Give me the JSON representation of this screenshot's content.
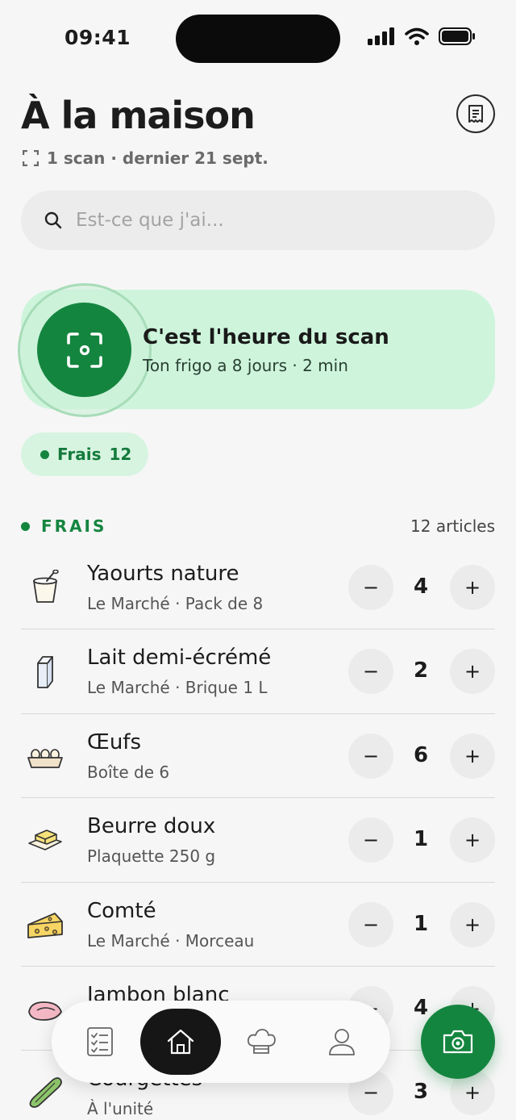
{
  "status_bar": {
    "time": "09:41"
  },
  "header": {
    "title": "À la maison",
    "scan_meta": "1 scan · dernier 21 sept."
  },
  "search": {
    "placeholder": "Est-ce que j'ai..."
  },
  "scan_card": {
    "title": "C'est l'heure du scan",
    "subtitle": "Ton frigo a 8 jours · 2 min"
  },
  "filter_chip": {
    "label": "Frais",
    "count": "12"
  },
  "section": {
    "title": "FRAIS",
    "count": "12 articles"
  },
  "items": [
    {
      "name": "Yaourts nature",
      "sub": "Le Marché · Pack de 8",
      "qty": "4",
      "icon": "yogurt-icon"
    },
    {
      "name": "Lait demi-écrémé",
      "sub": "Le Marché · Brique 1 L",
      "qty": "2",
      "icon": "milk-carton-icon"
    },
    {
      "name": "Œufs",
      "sub": "Boîte de 6",
      "qty": "6",
      "icon": "egg-box-icon"
    },
    {
      "name": "Beurre doux",
      "sub": "Plaquette 250 g",
      "qty": "1",
      "icon": "butter-icon"
    },
    {
      "name": "Comté",
      "sub": "Le Marché · Morceau",
      "qty": "1",
      "icon": "cheese-icon"
    },
    {
      "name": "Jambon blanc",
      "sub": "",
      "qty": "4",
      "icon": "ham-icon"
    },
    {
      "name": "Courgettes",
      "sub": "À l'unité",
      "qty": "3",
      "icon": "zucchini-icon"
    }
  ],
  "qty_controls": {
    "minus": "−",
    "plus": "+"
  },
  "nav": {
    "items": [
      "list-icon",
      "home-icon",
      "chef-hat-icon",
      "profile-icon"
    ],
    "active": "home-icon"
  },
  "colors": {
    "accent": "#14853f",
    "card": "#cef5dc",
    "background": "#f6f6f6"
  }
}
